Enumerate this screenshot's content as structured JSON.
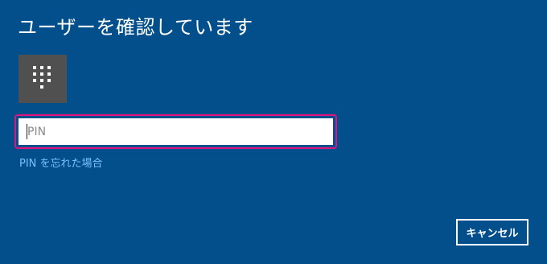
{
  "dialog": {
    "title": "ユーザーを確認しています"
  },
  "pin_tile": {
    "icon": "keypad-icon",
    "background": "#505050"
  },
  "pin_field": {
    "placeholder": "PIN",
    "value": "",
    "focus_border_color": "#e0137f"
  },
  "forgot_pin": {
    "label": "PIN を忘れた場合",
    "color": "#7cc1ff"
  },
  "buttons": {
    "cancel_label": "キャンセル"
  },
  "theme": {
    "background": "#024f8b"
  }
}
